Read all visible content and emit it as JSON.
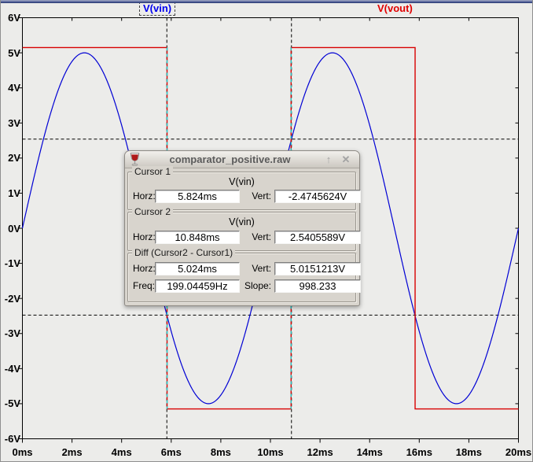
{
  "legend": {
    "vin": {
      "label": "V(vin)",
      "color": "#0000ee",
      "selected": true
    },
    "vout": {
      "label": "V(vout)",
      "color": "#e00000",
      "selected": false
    }
  },
  "chart_data": {
    "type": "line",
    "title": "",
    "grid": false,
    "legend_position": "top",
    "plot_background": "#ececea",
    "x": {
      "unit": "ms",
      "min": 0,
      "max": 20,
      "tick_step": 2,
      "tick_labels": [
        "0ms",
        "2ms",
        "4ms",
        "6ms",
        "8ms",
        "10ms",
        "12ms",
        "14ms",
        "16ms",
        "18ms",
        "20ms"
      ]
    },
    "y": {
      "unit": "V",
      "min": -6,
      "max": 6,
      "tick_step": 1,
      "tick_labels": [
        "6V",
        "5V",
        "4V",
        "3V",
        "2V",
        "1V",
        "0V",
        "-1V",
        "-2V",
        "-3V",
        "-4V",
        "-5V",
        "-6V"
      ]
    },
    "series": [
      {
        "name": "V(vin)",
        "color": "#0000d4",
        "shape": "sine",
        "amplitude_v": 5,
        "frequency_hz": 100,
        "offset_v": 0,
        "phase_deg": 0
      },
      {
        "name": "V(vout)",
        "color": "#d80000",
        "shape": "square",
        "high_v": 5.15,
        "low_v": -5.15,
        "initial_level": "high",
        "transition_times_ms": [
          5.833,
          10.833,
          15.833
        ]
      }
    ],
    "cursors": [
      {
        "name": "cursor1",
        "x_ms": 5.824,
        "y_v": -2.4745624,
        "line_color": "#000000",
        "xor_overlay_color": "#00e5e5"
      },
      {
        "name": "cursor2",
        "x_ms": 10.848,
        "y_v": 2.5405589,
        "line_color": "#000000",
        "xor_overlay_color": "#00e5e5"
      }
    ]
  },
  "cursor_dialog": {
    "title": "comparator_positive.raw",
    "icon": "wine-glass-icon",
    "buttons": {
      "shade": "↑",
      "close": "✕"
    },
    "labels": {
      "horz": "Horz:",
      "vert": "Vert:",
      "freq": "Freq:",
      "slope": "Slope:"
    },
    "cursor1": {
      "legend": "Cursor 1",
      "signal": "V(vin)",
      "horz_value": "5.824ms",
      "vert_value": "-2.4745624V"
    },
    "cursor2": {
      "legend": "Cursor 2",
      "signal": "V(vin)",
      "horz_value": "10.848ms",
      "vert_value": "2.5405589V"
    },
    "diff": {
      "legend": "Diff (Cursor2 - Cursor1)",
      "horz_value": "5.024ms",
      "vert_value": "5.0151213V",
      "freq_value": "199.04459Hz",
      "slope_value": "998.233"
    }
  }
}
